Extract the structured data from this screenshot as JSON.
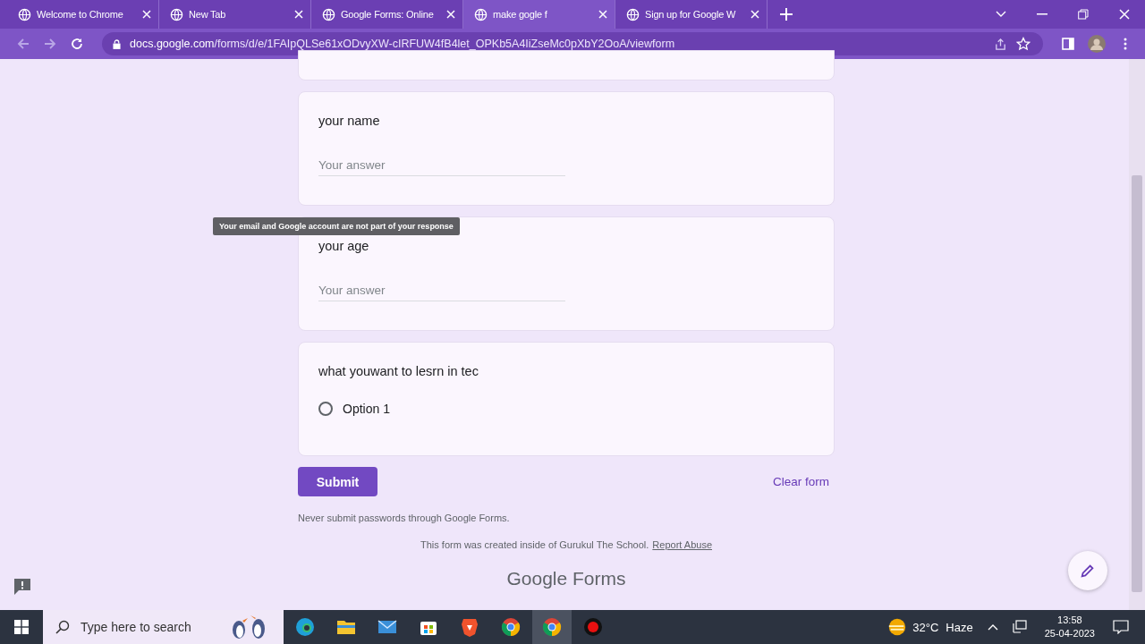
{
  "browser": {
    "tabs": [
      {
        "label": "Welcome to Chrome",
        "selected": false
      },
      {
        "label": "New Tab",
        "selected": false
      },
      {
        "label": "Google Forms: Online",
        "selected": false
      },
      {
        "label": "make gogle f",
        "selected": true
      },
      {
        "label": "Sign up for Google W",
        "selected": false
      }
    ],
    "url_host": "docs.google.com",
    "url_path": "/forms/d/e/1FAIpQLSe61xODvyXW-cIRFUW4fB4let_OPKb5A4IiZseMc0pXbY2OoA/viewform"
  },
  "tooltip": "Your email and Google account are not part of your response",
  "questions": [
    {
      "kind": "text",
      "title": "your name",
      "placeholder": "Your answer"
    },
    {
      "kind": "text",
      "title": "your age",
      "placeholder": "Your answer"
    },
    {
      "kind": "choice",
      "title": "what youwant to lesrn in tec",
      "options": [
        {
          "label": "Option 1",
          "selected": false
        }
      ]
    }
  ],
  "submit": "Submit",
  "clear": "Clear form",
  "notice": "Never submit passwords through Google Forms.",
  "footer": "This form was created inside of Gurukul The School.",
  "report": "Report Abuse",
  "brand": [
    "Google",
    "Forms"
  ],
  "taskbar": {
    "search_placeholder": "Type here to search",
    "temperature": "32°C",
    "weather": "Haze",
    "time": "13:58",
    "date": "25-04-2023"
  }
}
